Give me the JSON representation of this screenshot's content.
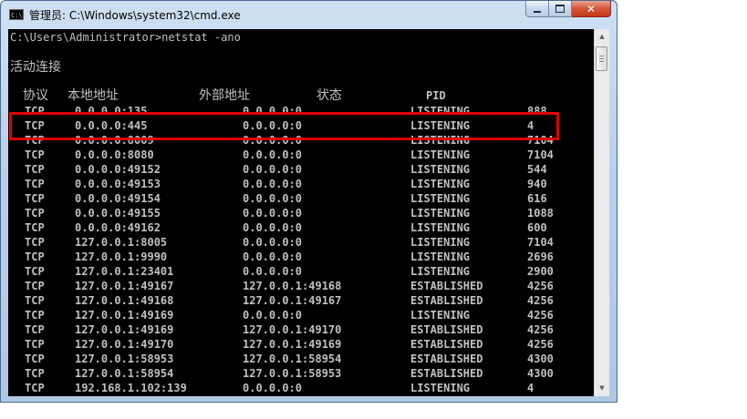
{
  "window": {
    "title": "管理员: C:\\Windows\\system32\\cmd.exe",
    "icon_text": "C:\\"
  },
  "console": {
    "prompt_line": "C:\\Users\\Administrator>netstat -ano",
    "section_title": "活动连接",
    "headers": {
      "proto": "协议",
      "local": "本地地址",
      "foreign": "外部地址",
      "state": "状态",
      "pid": "PID"
    },
    "rows": [
      {
        "proto": "TCP",
        "local": "0.0.0.0:135",
        "foreign": "0.0.0.0:0",
        "state": "LISTENING",
        "pid": "888"
      },
      {
        "proto": "TCP",
        "local": "0.0.0.0:445",
        "foreign": "0.0.0.0:0",
        "state": "LISTENING",
        "pid": "4"
      },
      {
        "proto": "TCP",
        "local": "0.0.0.0:8009",
        "foreign": "0.0.0.0:0",
        "state": "LISTENING",
        "pid": "7104"
      },
      {
        "proto": "TCP",
        "local": "0.0.0.0:8080",
        "foreign": "0.0.0.0:0",
        "state": "LISTENING",
        "pid": "7104"
      },
      {
        "proto": "TCP",
        "local": "0.0.0.0:49152",
        "foreign": "0.0.0.0:0",
        "state": "LISTENING",
        "pid": "544"
      },
      {
        "proto": "TCP",
        "local": "0.0.0.0:49153",
        "foreign": "0.0.0.0:0",
        "state": "LISTENING",
        "pid": "940"
      },
      {
        "proto": "TCP",
        "local": "0.0.0.0:49154",
        "foreign": "0.0.0.0:0",
        "state": "LISTENING",
        "pid": "616"
      },
      {
        "proto": "TCP",
        "local": "0.0.0.0:49155",
        "foreign": "0.0.0.0:0",
        "state": "LISTENING",
        "pid": "1088"
      },
      {
        "proto": "TCP",
        "local": "0.0.0.0:49162",
        "foreign": "0.0.0.0:0",
        "state": "LISTENING",
        "pid": "600"
      },
      {
        "proto": "TCP",
        "local": "127.0.0.1:8005",
        "foreign": "0.0.0.0:0",
        "state": "LISTENING",
        "pid": "7104"
      },
      {
        "proto": "TCP",
        "local": "127.0.0.1:9990",
        "foreign": "0.0.0.0:0",
        "state": "LISTENING",
        "pid": "2696"
      },
      {
        "proto": "TCP",
        "local": "127.0.0.1:23401",
        "foreign": "0.0.0.0:0",
        "state": "LISTENING",
        "pid": "2900"
      },
      {
        "proto": "TCP",
        "local": "127.0.0.1:49167",
        "foreign": "127.0.0.1:49168",
        "state": "ESTABLISHED",
        "pid": "4256"
      },
      {
        "proto": "TCP",
        "local": "127.0.0.1:49168",
        "foreign": "127.0.0.1:49167",
        "state": "ESTABLISHED",
        "pid": "4256"
      },
      {
        "proto": "TCP",
        "local": "127.0.0.1:49169",
        "foreign": "0.0.0.0:0",
        "state": "LISTENING",
        "pid": "4256"
      },
      {
        "proto": "TCP",
        "local": "127.0.0.1:49169",
        "foreign": "127.0.0.1:49170",
        "state": "ESTABLISHED",
        "pid": "4256"
      },
      {
        "proto": "TCP",
        "local": "127.0.0.1:49170",
        "foreign": "127.0.0.1:49169",
        "state": "ESTABLISHED",
        "pid": "4256"
      },
      {
        "proto": "TCP",
        "local": "127.0.0.1:58953",
        "foreign": "127.0.0.1:58954",
        "state": "ESTABLISHED",
        "pid": "4300"
      },
      {
        "proto": "TCP",
        "local": "127.0.0.1:58954",
        "foreign": "127.0.0.1:58953",
        "state": "ESTABLISHED",
        "pid": "4300"
      },
      {
        "proto": "TCP",
        "local": "192.168.1.102:139",
        "foreign": "0.0.0.0:0",
        "state": "LISTENING",
        "pid": "4"
      }
    ]
  },
  "icons": {
    "minimize": "minimize-icon",
    "maximize": "maximize-icon",
    "close": "close-icon",
    "scroll_up": "scroll-up-arrow-icon",
    "scroll_down": "scroll-down-arrow-icon"
  },
  "colors": {
    "console_bg": "#000000",
    "console_text": "#c0c0c0",
    "highlight": "#e00000"
  }
}
